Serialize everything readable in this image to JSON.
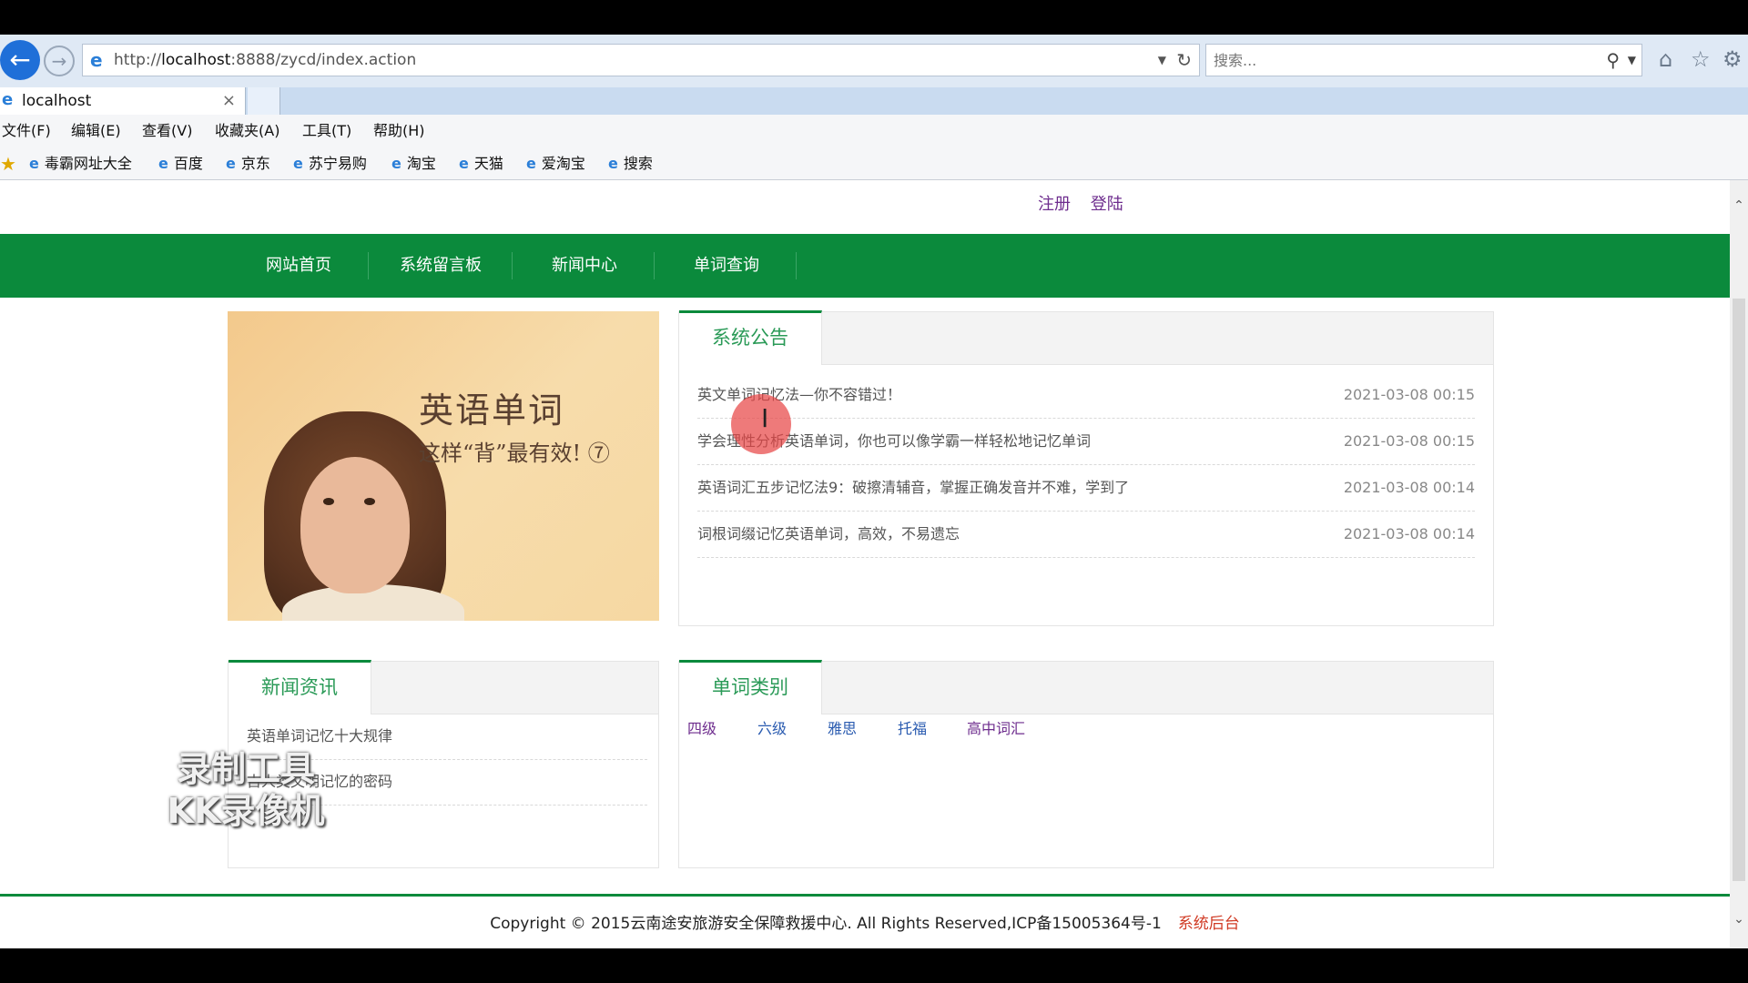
{
  "browser": {
    "url_prefix": "http://",
    "url_host": "localhost",
    "url_rest": ":8888/zycd/index.action",
    "search_placeholder": "搜索...",
    "tab_title": "localhost",
    "menu": [
      "文件(F)",
      "编辑(E)",
      "查看(V)",
      "收藏夹(A)",
      "工具(T)",
      "帮助(H)"
    ],
    "favorites": [
      "毒霸网址大全",
      "百度",
      "京东",
      "苏宁易购",
      "淘宝",
      "天猫",
      "爱淘宝",
      "搜索"
    ]
  },
  "header": {
    "register": "注册",
    "login": "登陆"
  },
  "nav": [
    "网站首页",
    "系统留言板",
    "新闻中心",
    "单词查询"
  ],
  "banner": {
    "title": "英语单词",
    "subtitle": "这样“背”最有效! ⑦"
  },
  "notices": {
    "heading": "系统公告",
    "items": [
      {
        "title": "英文单词记忆法—你不容错过！",
        "date": "2021-03-08 00:15"
      },
      {
        "title": "学会理性分析英语单词，你也可以像学霸一样轻松地记忆单词",
        "date": "2021-03-08 00:15"
      },
      {
        "title": "英语词汇五步记忆法9：破擦清辅音，掌握正确发音并不难，学到了",
        "date": "2021-03-08 00:14"
      },
      {
        "title": "词根词缀记忆英语单词，高效，不易遗忘",
        "date": "2021-03-08 00:14"
      }
    ]
  },
  "news": {
    "heading": "新闻资讯",
    "items": [
      "英语单词记忆十大规律",
      "古人类文明记忆的密码"
    ]
  },
  "categories": {
    "heading": "单词类别",
    "items": [
      "四级",
      "六级",
      "雅思",
      "托福",
      "高中词汇"
    ]
  },
  "footer": {
    "copyright": "Copyright © 2015云南途安旅游安全保障救援中心. All Rights Reserved,ICP备15005364号-1",
    "admin_link": "系统后台"
  },
  "watermark": {
    "line1": "录制工具",
    "line2": "KK录像机"
  },
  "colors": {
    "nav_green": "#0b8a3c",
    "link_purple": "#6e2d8e",
    "admin_red": "#d03a24"
  }
}
